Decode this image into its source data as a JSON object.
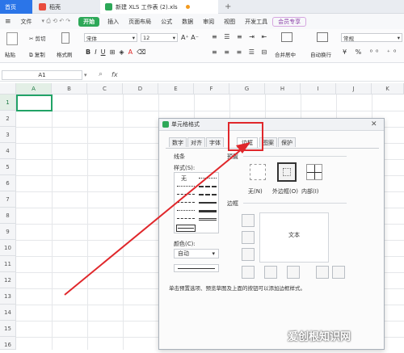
{
  "tabs": [
    {
      "label": "首页"
    },
    {
      "label": "稻壳"
    },
    {
      "label": "新建 XLS 工作表 (2).xls"
    }
  ],
  "menu": {
    "file": "文件",
    "start": "开始",
    "items": [
      "插入",
      "页面布局",
      "公式",
      "数据",
      "审阅",
      "视图",
      "开发工具",
      "会员专享"
    ]
  },
  "ribbon": {
    "paste": "粘贴",
    "cut": "剪切",
    "copy": "复制",
    "format_painter": "格式刷",
    "font_name": "宋体",
    "font_size": "12",
    "merge": "合并居中",
    "wrap": "自动换行",
    "number_format": "常规"
  },
  "formula": {
    "name_box": "A1",
    "fx": "fx"
  },
  "grid": {
    "columns": [
      "A",
      "B",
      "C",
      "D",
      "E",
      "F",
      "G",
      "H",
      "I",
      "J",
      "K"
    ],
    "rows": [
      "1",
      "2",
      "3",
      "4",
      "5",
      "6",
      "7",
      "8",
      "9",
      "10",
      "11",
      "12",
      "13",
      "14",
      "15",
      "16"
    ]
  },
  "dialog": {
    "title": "单元格格式",
    "tabs": [
      "数字",
      "对齐",
      "字体",
      "边框",
      "图案",
      "保护"
    ],
    "active_tab": "边框",
    "line_group": "线条",
    "style_label": "样式(S):",
    "none_style": "无",
    "color_label": "颜色(C):",
    "color_value": "自动",
    "presets_label": "预置",
    "preset_none": "无(N)",
    "preset_outline": "外边框(O)",
    "preset_inside": "内部(I)",
    "border_label": "边框",
    "preview_text": "文本",
    "hint": "单击预置选项、预览草图及上面的按钮可以添加边框样式。"
  },
  "watermark": "爱创根知识网",
  "colors": {
    "accent_green": "#2da858",
    "annotation_red": "#e0272b",
    "selection_green": "#21a366"
  }
}
